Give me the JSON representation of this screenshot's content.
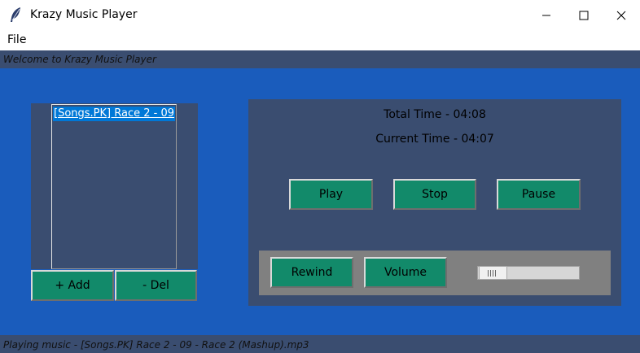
{
  "window": {
    "title": "Krazy Music Player",
    "icon": "feather-icon"
  },
  "menu": {
    "file": "File"
  },
  "status": {
    "top": "Welcome to Krazy Music Player",
    "bottom": "Playing music - [Songs.PK] Race 2 - 09 - Race 2 (Mashup).mp3"
  },
  "playlist": {
    "items": [
      "[Songs.PK] Race 2 - 09"
    ],
    "selected_index": 0,
    "add_label": "+ Add",
    "del_label": "- Del"
  },
  "player": {
    "total_time": "Total Time - 04:08",
    "current_time": "Current Time - 04:07",
    "play_label": "Play",
    "stop_label": "Stop",
    "pause_label": "Pause",
    "rewind_label": "Rewind",
    "volume_label": "Volume",
    "volume_level": 0
  },
  "colors": {
    "main_bg": "#1a5cbc",
    "panel_bg": "#3a4d70",
    "button_bg": "#128a6a",
    "control_bar_bg": "#808080",
    "selection": "#0078d7"
  }
}
